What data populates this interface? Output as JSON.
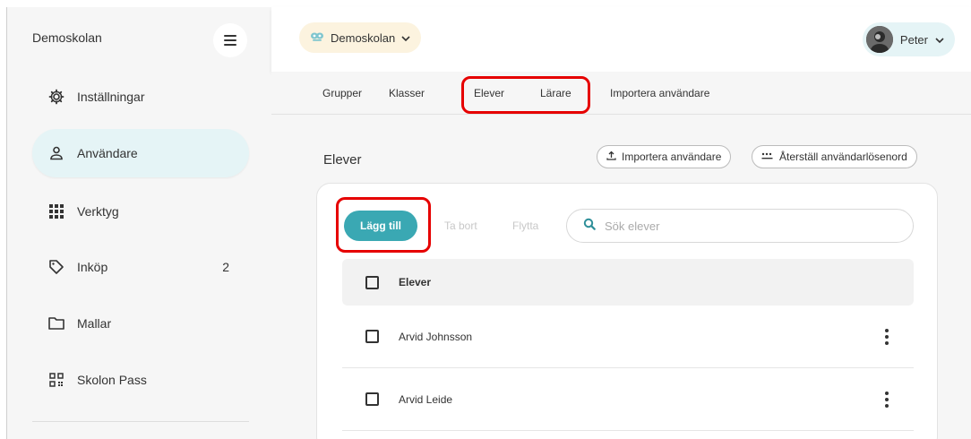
{
  "sidebar": {
    "school_name": "Demoskolan",
    "items": [
      {
        "label": "Inställningar",
        "icon": "gear-icon",
        "badge": ""
      },
      {
        "label": "Användare",
        "icon": "user-icon",
        "badge": "",
        "active": true
      },
      {
        "label": "Verktyg",
        "icon": "grid-icon",
        "badge": ""
      },
      {
        "label": "Inköp",
        "icon": "tag-icon",
        "badge": "2"
      },
      {
        "label": "Mallar",
        "icon": "folder-icon",
        "badge": ""
      },
      {
        "label": "Skolon Pass",
        "icon": "qr-icon",
        "badge": ""
      }
    ]
  },
  "topbar": {
    "school_selector": "Demoskolan",
    "user_name": "Peter"
  },
  "tabs": [
    "Grupper",
    "Klasser",
    "Elever",
    "Lärare",
    "Importera användare"
  ],
  "main": {
    "title": "Elever",
    "import_button": "Importera användare",
    "reset_button": "Återställ användarlösenord",
    "add_button": "Lägg till",
    "remove_button": "Ta bort",
    "move_button": "Flytta",
    "search_placeholder": "Sök elever",
    "table_header": "Elever",
    "rows": [
      "Arvid Johnsson",
      "Arvid Leide"
    ]
  },
  "colors": {
    "accent": "#3aa8b3",
    "active_nav": "#e5f4f6",
    "school_pill": "#fcf3df",
    "highlight": "#e60000"
  }
}
